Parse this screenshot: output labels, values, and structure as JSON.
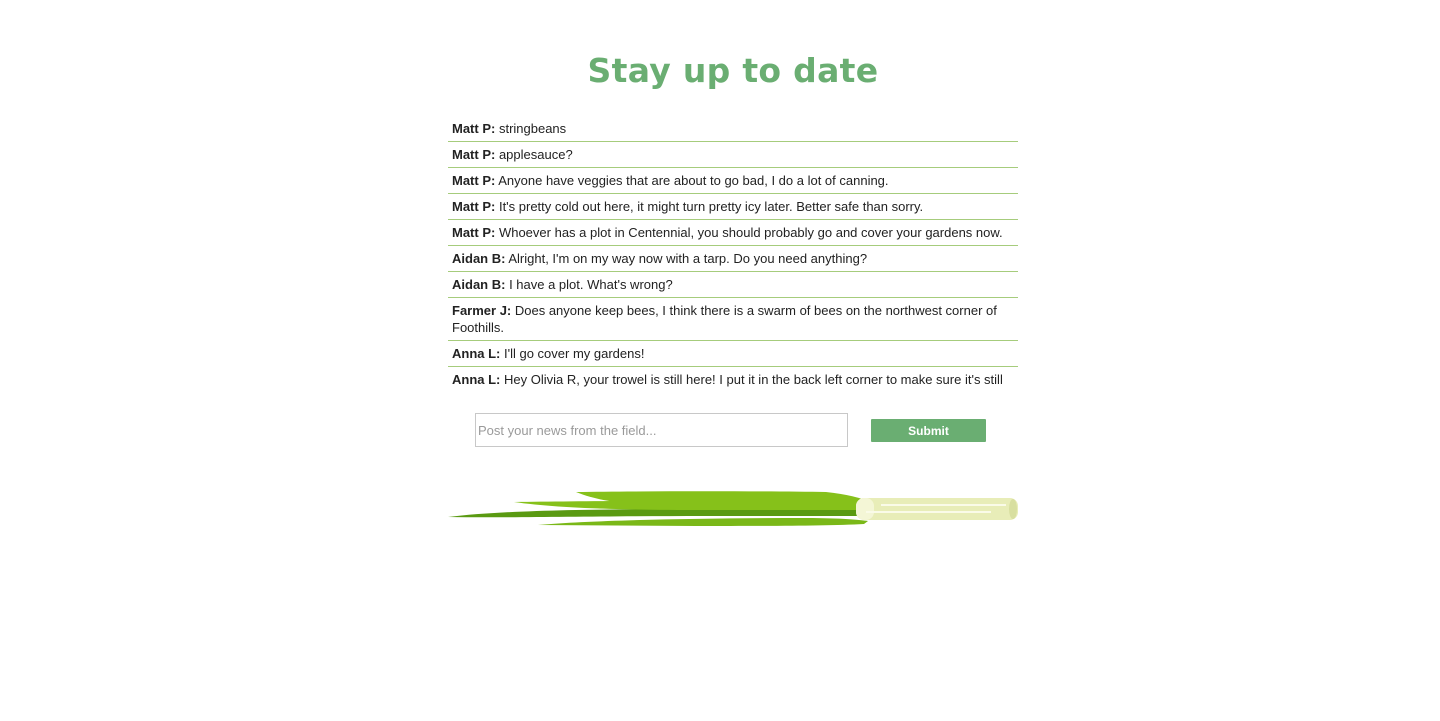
{
  "header": {
    "title": "Stay up to date"
  },
  "feed": {
    "messages": [
      {
        "author": "Matt P:",
        "text": " stringbeans"
      },
      {
        "author": "Matt P:",
        "text": " applesauce?"
      },
      {
        "author": "Matt P:",
        "text": " Anyone have veggies that are about to go bad, I do a lot of canning."
      },
      {
        "author": "Matt P:",
        "text": " It's pretty cold out here, it might turn pretty icy later. Better safe than sorry."
      },
      {
        "author": "Matt P:",
        "text": " Whoever has a plot in Centennial, you should probably go and cover your gardens now."
      },
      {
        "author": "Aidan B:",
        "text": " Alright, I'm on my way now with a tarp. Do you need anything?"
      },
      {
        "author": "Aidan B:",
        "text": " I have a plot. What's wrong?"
      },
      {
        "author": "Farmer J:",
        "text": " Does anyone keep bees, I think there is a swarm of bees on the northwest corner of Foothills."
      },
      {
        "author": "Anna L:",
        "text": " I'll go cover my gardens!"
      },
      {
        "author": "Anna L:",
        "text": " Hey Olivia R, your trowel is still here! I put it in the back left corner to make sure it's still"
      }
    ]
  },
  "form": {
    "placeholder": "Post your news from the field...",
    "value": "",
    "submit_label": "Submit"
  },
  "colors": {
    "accent": "#6aae72",
    "divider": "#a6cc7c",
    "scallion_dark": "#5a9a12",
    "scallion_light": "#86c11a",
    "scallion_stem": "#e8edb8"
  },
  "icons": {
    "decoration": "scallion-illustration"
  }
}
